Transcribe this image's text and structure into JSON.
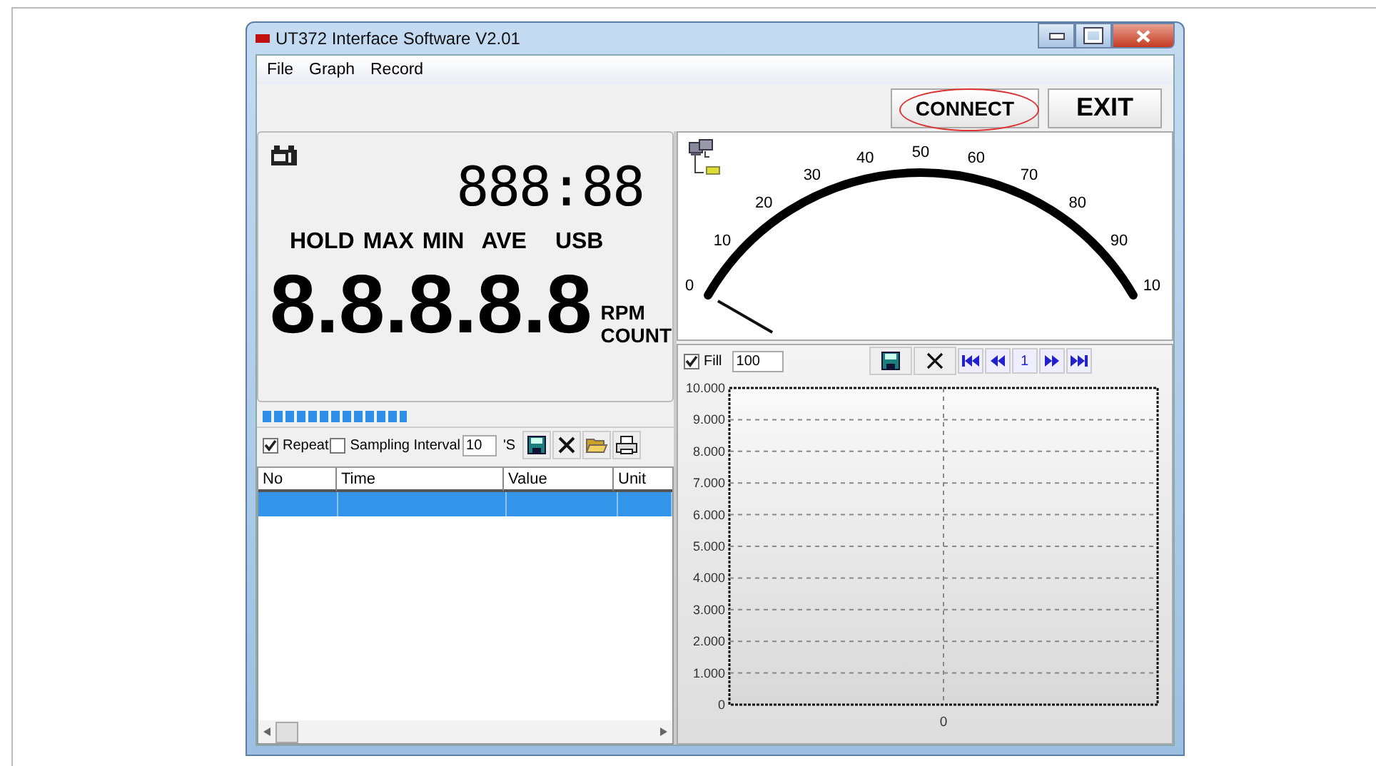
{
  "window": {
    "title": "UT372 Interface Software V2.01"
  },
  "menu": [
    "File",
    "Graph",
    "Record"
  ],
  "toolbar": {
    "connect": "CONNECT",
    "exit": "EXIT"
  },
  "display": {
    "clock": "888:88",
    "flags": [
      "HOLD",
      "MAX",
      "MIN",
      "AVE",
      "USB"
    ],
    "reading": "8.8.8.8.8",
    "units": [
      "RPM",
      "COUNT"
    ]
  },
  "record_bar": {
    "repeat": {
      "label": "Repeat",
      "checked": true
    },
    "sampling": {
      "label": "Sampling Interval",
      "checked": false
    },
    "interval": "10",
    "unit": "'S"
  },
  "table": {
    "columns": [
      "No",
      "Time",
      "Value",
      "Unit"
    ],
    "rows": [
      {
        "selected": true
      }
    ]
  },
  "gauge": {
    "ticks": [
      "0",
      "10",
      "20",
      "30",
      "40",
      "50",
      "60",
      "70",
      "80",
      "90",
      "10"
    ]
  },
  "graph_bar": {
    "fill": {
      "label": "Fill",
      "checked": true
    },
    "points": "100",
    "page": "1"
  },
  "graph": {
    "y_labels": [
      "10.000",
      "9.000",
      "8.000",
      "7.000",
      "6.000",
      "5.000",
      "4.000",
      "3.000",
      "2.000",
      "1.000",
      "0"
    ],
    "x_label": "0"
  }
}
